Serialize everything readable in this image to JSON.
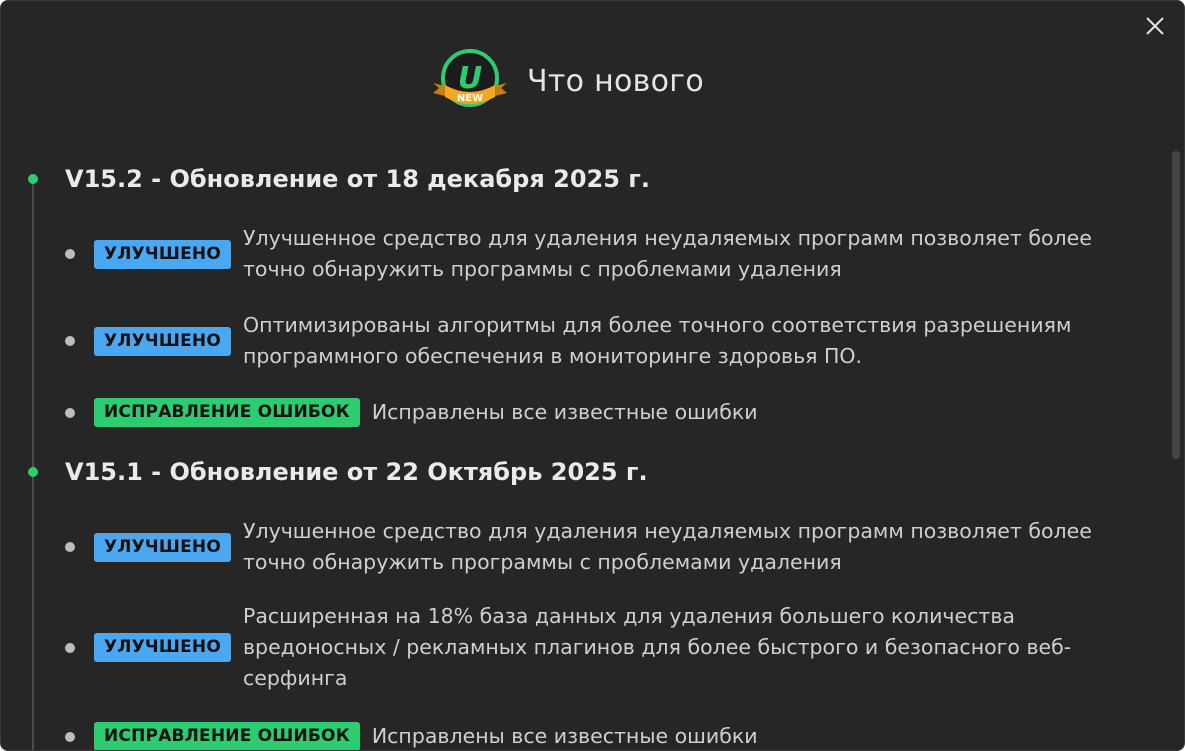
{
  "window": {
    "title": "Что нового",
    "logo_label": "NEW",
    "logo_letter": "U"
  },
  "colors": {
    "background": "#262626",
    "accent_green": "#2ecc71",
    "badge_improved": "#4aa8f2",
    "badge_fix": "#2ecc71",
    "logo_ribbon": "#f5a623"
  },
  "icons": {
    "close": "close-icon",
    "logo": "app-logo-icon"
  },
  "versions": [
    {
      "title": "V15.2 - Обновление от 18 декабря 2025 г.",
      "items": [
        {
          "badge": "УЛУЧШЕНО",
          "type": "improved",
          "text": "Улучшенное средство для удаления неудаляемых программ позволяет более точно обнаружить программы с проблемами удаления"
        },
        {
          "badge": "УЛУЧШЕНО",
          "type": "improved",
          "text": "Оптимизированы алгоритмы для более точного соответствия разрешениям программного обеспечения в мониторинге здоровья ПО."
        },
        {
          "badge": "ИСПРАВЛЕНИЕ ОШИБОК",
          "type": "fix",
          "text": "Исправлены все известные ошибки"
        }
      ]
    },
    {
      "title": "V15.1 - Обновление от 22 Октябрь 2025 г.",
      "items": [
        {
          "badge": "УЛУЧШЕНО",
          "type": "improved",
          "text": "Улучшенное средство для удаления неудаляемых программ позволяет более точно обнаружить программы с проблемами удаления"
        },
        {
          "badge": "УЛУЧШЕНО",
          "type": "improved",
          "text": "Расширенная на 18% база данных для удаления большего количества вредоносных / рекламных плагинов для более быстрого и безопасного веб-серфинга"
        },
        {
          "badge": "ИСПРАВЛЕНИЕ ОШИБОК",
          "type": "fix",
          "text": "Исправлены все известные ошибки"
        }
      ]
    }
  ]
}
